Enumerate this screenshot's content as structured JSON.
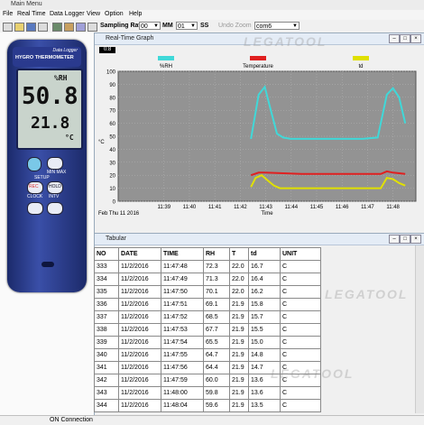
{
  "window": {
    "title": "Main Menu"
  },
  "menu": [
    "File",
    "Real Time",
    "Data Logger",
    "View",
    "Option",
    "Help"
  ],
  "toolbar": {
    "sampling_label": "Sampling Rate",
    "hh": "00",
    "mm_label": "MM",
    "mm": "01",
    "ss_label": "SS",
    "undo_zoom": "Undo Zoom",
    "port": "com6"
  },
  "device": {
    "label1": "Data Logger",
    "label2": "HYGRO THERMOMETER",
    "unit_rh": "%RH",
    "rh_value": "50.8",
    "temp_value": "21.8",
    "unit_c": "°C",
    "btn_minmax": "MIN MAX",
    "btn_setup": "SETUP",
    "btn_rec": "REC",
    "btn_hold": "HOLD",
    "btn_clock": "CLOCK",
    "btn_intv": "INTV"
  },
  "graph_window": {
    "title": "Real-Time Graph",
    "badge": "0.8"
  },
  "chart_data": {
    "type": "line",
    "legend": [
      "%RH",
      "Temperature",
      "td"
    ],
    "colors": {
      "%RH": "#40d8d8",
      "Temperature": "#e02020",
      "td": "#e0e000"
    },
    "y_ticks": [
      0,
      10,
      20,
      30,
      40,
      50,
      60,
      70,
      80,
      90,
      100
    ],
    "ylim": [
      0,
      100
    ],
    "y_unit": "°C",
    "x_ticks": [
      "11:39",
      "11:40",
      "11:41",
      "11:42",
      "11:43",
      "11:44",
      "11:45",
      "11:46",
      "11:47",
      "11:48"
    ],
    "x_start_label": "Feb Thu 11 2016",
    "xlabel": "Time",
    "series": [
      {
        "name": "%RH",
        "x": [
          11.707,
          11.712,
          11.716,
          11.72,
          11.724,
          11.728,
          11.733,
          11.74,
          11.76,
          11.78,
          11.79,
          11.796,
          11.8,
          11.804,
          11.808
        ],
        "values": [
          48,
          82,
          88,
          70,
          52,
          49,
          48,
          48,
          48,
          48,
          49,
          82,
          87,
          80,
          60
        ]
      },
      {
        "name": "Temperature",
        "x": [
          11.707,
          11.712,
          11.716,
          11.74,
          11.76,
          11.78,
          11.792,
          11.796,
          11.8,
          11.808
        ],
        "values": [
          20,
          22,
          22,
          21,
          21,
          21,
          21,
          23,
          22,
          21
        ]
      },
      {
        "name": "td",
        "x": [
          11.707,
          11.71,
          11.714,
          11.718,
          11.722,
          11.726,
          11.74,
          11.76,
          11.78,
          11.792,
          11.796,
          11.8,
          11.804,
          11.808
        ],
        "values": [
          11,
          18,
          20,
          16,
          12,
          10,
          10,
          10,
          10,
          10,
          18,
          17,
          14,
          12
        ]
      }
    ]
  },
  "tab_window": {
    "title": "Tabular"
  },
  "table": {
    "columns": [
      "NO",
      "DATE",
      "TIME",
      "RH",
      "T",
      "td",
      "UNIT"
    ],
    "rows": [
      [
        "333",
        "11/2/2016",
        "11:47:48",
        "72.3",
        "22.0",
        "16.7",
        "C"
      ],
      [
        "334",
        "11/2/2016",
        "11:47:49",
        "71.3",
        "22.0",
        "16.4",
        "C"
      ],
      [
        "335",
        "11/2/2016",
        "11:47:50",
        "70.1",
        "22.0",
        "16.2",
        "C"
      ],
      [
        "336",
        "11/2/2016",
        "11:47:51",
        "69.1",
        "21.9",
        "15.8",
        "C"
      ],
      [
        "337",
        "11/2/2016",
        "11:47:52",
        "68.5",
        "21.9",
        "15.7",
        "C"
      ],
      [
        "338",
        "11/2/2016",
        "11:47:53",
        "67.7",
        "21.9",
        "15.5",
        "C"
      ],
      [
        "339",
        "11/2/2016",
        "11:47:54",
        "65.5",
        "21.9",
        "15.0",
        "C"
      ],
      [
        "340",
        "11/2/2016",
        "11:47:55",
        "64.7",
        "21.9",
        "14.8",
        "C"
      ],
      [
        "341",
        "11/2/2016",
        "11:47:56",
        "64.4",
        "21.9",
        "14.7",
        "C"
      ],
      [
        "342",
        "11/2/2016",
        "11:47:59",
        "60.0",
        "21.9",
        "13.6",
        "C"
      ],
      [
        "343",
        "11/2/2016",
        "11:48:00",
        "59.8",
        "21.9",
        "13.6",
        "C"
      ],
      [
        "344",
        "11/2/2016",
        "11:48:04",
        "59.6",
        "21.9",
        "13.5",
        "C"
      ]
    ]
  },
  "status": {
    "text": "ON Connection"
  },
  "watermark": "LEGATOOL"
}
